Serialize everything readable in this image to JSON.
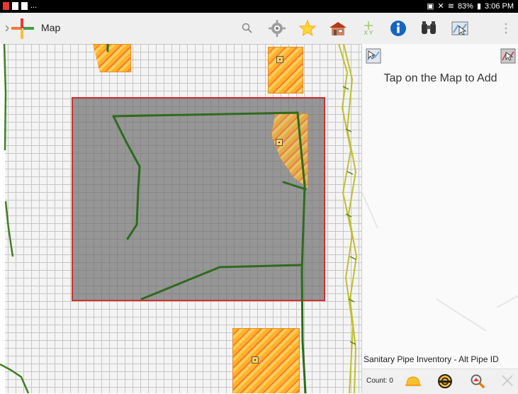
{
  "status_bar": {
    "left_dots": "...",
    "battery": "83%",
    "time": "3:06 PM"
  },
  "app_bar": {
    "title": "Map",
    "icons": [
      "app-logo-icon",
      "search-icon",
      "gps-locate-icon",
      "favorites-star-icon",
      "home-building-icon",
      "xy-coordinates-icon",
      "info-icon",
      "binoculars-icon",
      "map-select-icon",
      "overflow-menu-icon"
    ],
    "xy_label": "X Y"
  },
  "panel": {
    "message": "Tap on the Map to Add",
    "layer_name": "Sanitary Pipe Inventory - Alt Pipe ID",
    "count_text": "Count: 0",
    "footer_icons": [
      "hard-hat-icon",
      "target-icon",
      "zoom-search-icon",
      "close-icon"
    ]
  },
  "colors": {
    "selection_fill": "#6e6e6e",
    "selection_border": "#d32f2f",
    "pipe_line": "#2e6b1e",
    "parcel_hatch": "#ffb22c"
  }
}
